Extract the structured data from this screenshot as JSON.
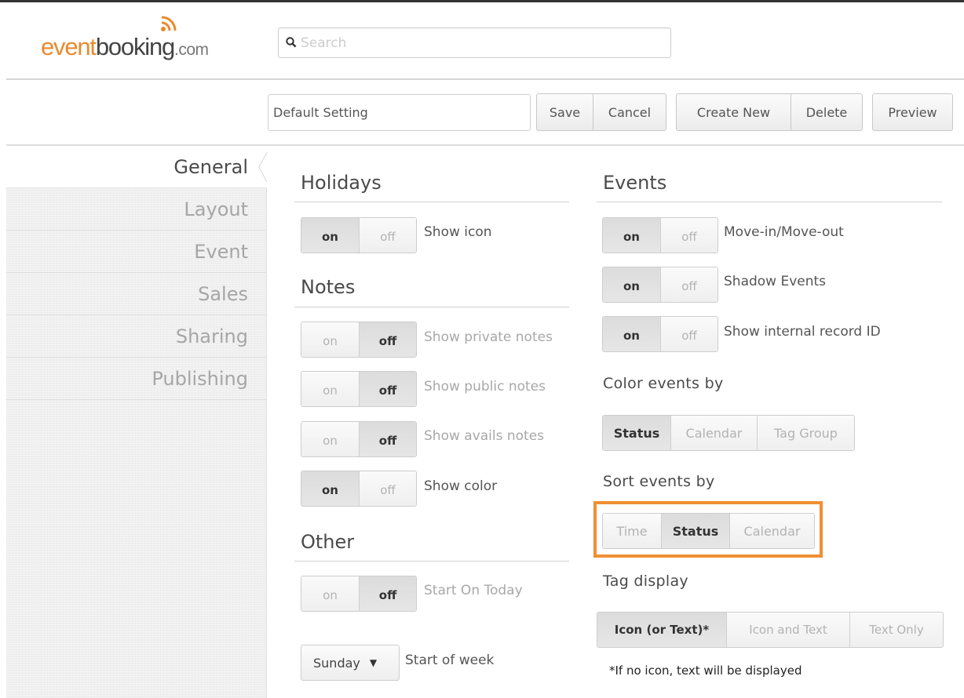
{
  "header": {
    "logo": {
      "part1": "event",
      "part2": "booking",
      "part3": ".com"
    },
    "search": {
      "placeholder": "Search",
      "value": ""
    }
  },
  "toolbar": {
    "setting_name": "Default Setting",
    "save": "Save",
    "cancel": "Cancel",
    "create_new": "Create New",
    "delete": "Delete",
    "preview": "Preview"
  },
  "sidebar": {
    "items": [
      {
        "label": "General",
        "active": true
      },
      {
        "label": "Layout",
        "active": false
      },
      {
        "label": "Event",
        "active": false
      },
      {
        "label": "Sales",
        "active": false
      },
      {
        "label": "Sharing",
        "active": false
      },
      {
        "label": "Publishing",
        "active": false
      }
    ]
  },
  "toggle": {
    "on": "on",
    "off": "off"
  },
  "holidays": {
    "title": "Holidays",
    "options": [
      {
        "label": "Show icon",
        "value": "on"
      }
    ]
  },
  "notes": {
    "title": "Notes",
    "options": [
      {
        "label": "Show private notes",
        "value": "off"
      },
      {
        "label": "Show public notes",
        "value": "off"
      },
      {
        "label": "Show avails notes",
        "value": "off"
      },
      {
        "label": "Show color",
        "value": "on"
      }
    ]
  },
  "other": {
    "title": "Other",
    "options": [
      {
        "label": "Start On Today",
        "value": "off"
      }
    ],
    "week_start": {
      "value": "Sunday",
      "label": "Start of week"
    }
  },
  "events": {
    "title": "Events",
    "options": [
      {
        "label": "Move-in/Move-out",
        "value": "on"
      },
      {
        "label": "Shadow Events",
        "value": "on"
      },
      {
        "label": "Show internal record ID",
        "value": "on"
      }
    ],
    "color_by": {
      "label": "Color events by",
      "options": [
        "Status",
        "Calendar",
        "Tag Group"
      ],
      "selected": "Status"
    },
    "sort_by": {
      "label": "Sort events by",
      "options": [
        "Time",
        "Status",
        "Calendar"
      ],
      "selected": "Status"
    },
    "tag_display": {
      "label": "Tag display",
      "options": [
        "Icon (or Text)*",
        "Icon and Text",
        "Text Only"
      ],
      "selected": "Icon (or Text)*",
      "footnote": "*If no icon, text will be displayed"
    }
  },
  "colors": {
    "accent": "#e98a2e",
    "highlight": "#ef8f33"
  }
}
